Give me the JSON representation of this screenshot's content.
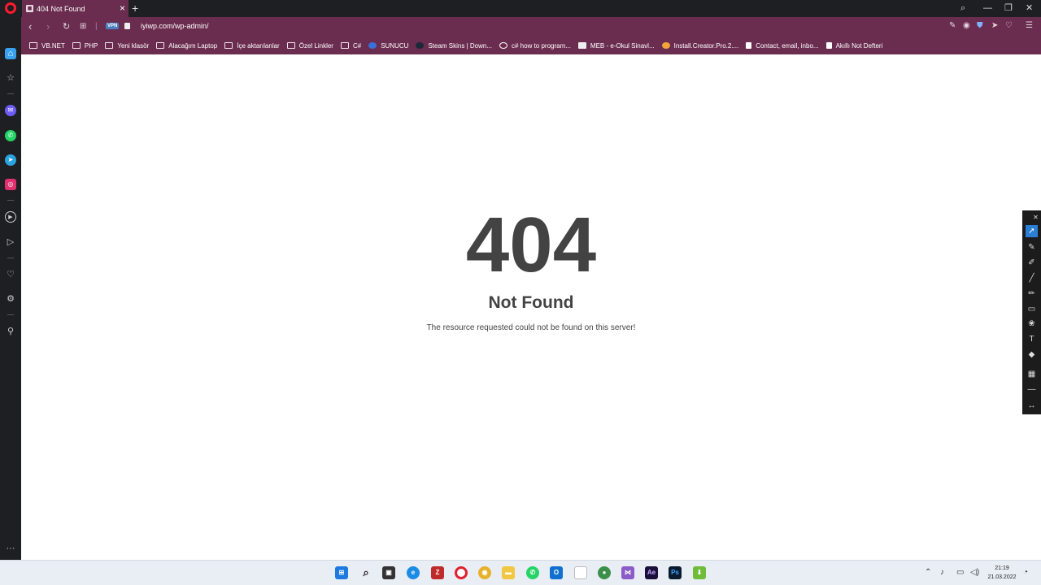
{
  "browser": {
    "tab_title": "404 Not Found",
    "tab_close": "×",
    "new_tab": "+",
    "url": "iyiwp.com/wp-admin/",
    "vpn_label": "VPN",
    "accent_color": "#6b2d4f"
  },
  "bookmarks": [
    {
      "label": "VB.NET",
      "icon": "folder-icon"
    },
    {
      "label": "PHP",
      "icon": "folder-icon"
    },
    {
      "label": "Yeni klasör",
      "icon": "folder-icon"
    },
    {
      "label": "Alacağım Laptop",
      "icon": "folder-icon"
    },
    {
      "label": "İçe aktarılanlar",
      "icon": "folder-icon"
    },
    {
      "label": "Özel Linkler",
      "icon": "folder-icon"
    },
    {
      "label": "C#",
      "icon": "folder-icon"
    },
    {
      "label": "SUNUCU",
      "icon": "server-icon"
    },
    {
      "label": "Steam Skins | Down...",
      "icon": "steam-icon"
    },
    {
      "label": "c# how to program...",
      "icon": "google-icon"
    },
    {
      "label": "MEB - e-Okul Sinavl...",
      "icon": "meb-icon"
    },
    {
      "label": "Install.Creator.Pro.2....",
      "icon": "site-icon"
    },
    {
      "label": "Contact, email, inbo...",
      "icon": "page-icon"
    },
    {
      "label": "Akıllı Not Defteri",
      "icon": "page-icon"
    }
  ],
  "page": {
    "code": "404",
    "heading": "Not Found",
    "message": "The resource requested could not be found on this server!"
  },
  "taskbar": {
    "time": "21:19",
    "date": "21.03.2022"
  }
}
